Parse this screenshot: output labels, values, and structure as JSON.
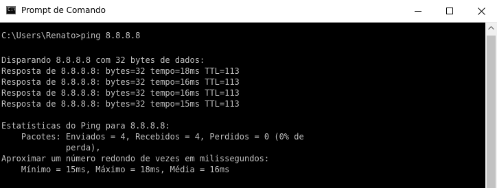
{
  "window": {
    "title": "Prompt de Comando",
    "icon_text": "C:\\"
  },
  "console": {
    "lines": [
      "C:\\Users\\Renato>ping 8.8.8.8",
      "",
      "Disparando 8.8.8.8 com 32 bytes de dados:",
      "Resposta de 8.8.8.8: bytes=32 tempo=18ms TTL=113",
      "Resposta de 8.8.8.8: bytes=32 tempo=16ms TTL=113",
      "Resposta de 8.8.8.8: bytes=32 tempo=16ms TTL=113",
      "Resposta de 8.8.8.8: bytes=32 tempo=15ms TTL=113",
      "",
      "Estatísticas do Ping para 8.8.8.8:",
      "    Pacotes: Enviados = 4, Recebidos = 4, Perdidos = 0 (0% de",
      "             perda),",
      "Aproximar um número redondo de vezes em milissegundos:",
      "    Mínimo = 15ms, Máximo = 18ms, Média = 16ms"
    ]
  },
  "colors": {
    "console_bg": "#000000",
    "console_text": "#c0c0c0",
    "titlebar_bg": "#ffffff"
  },
  "icons": {
    "app": "cmd-icon",
    "minimize": "minimize-icon",
    "maximize": "maximize-icon",
    "close": "close-icon",
    "scroll_up": "scroll-up-arrow-icon"
  }
}
